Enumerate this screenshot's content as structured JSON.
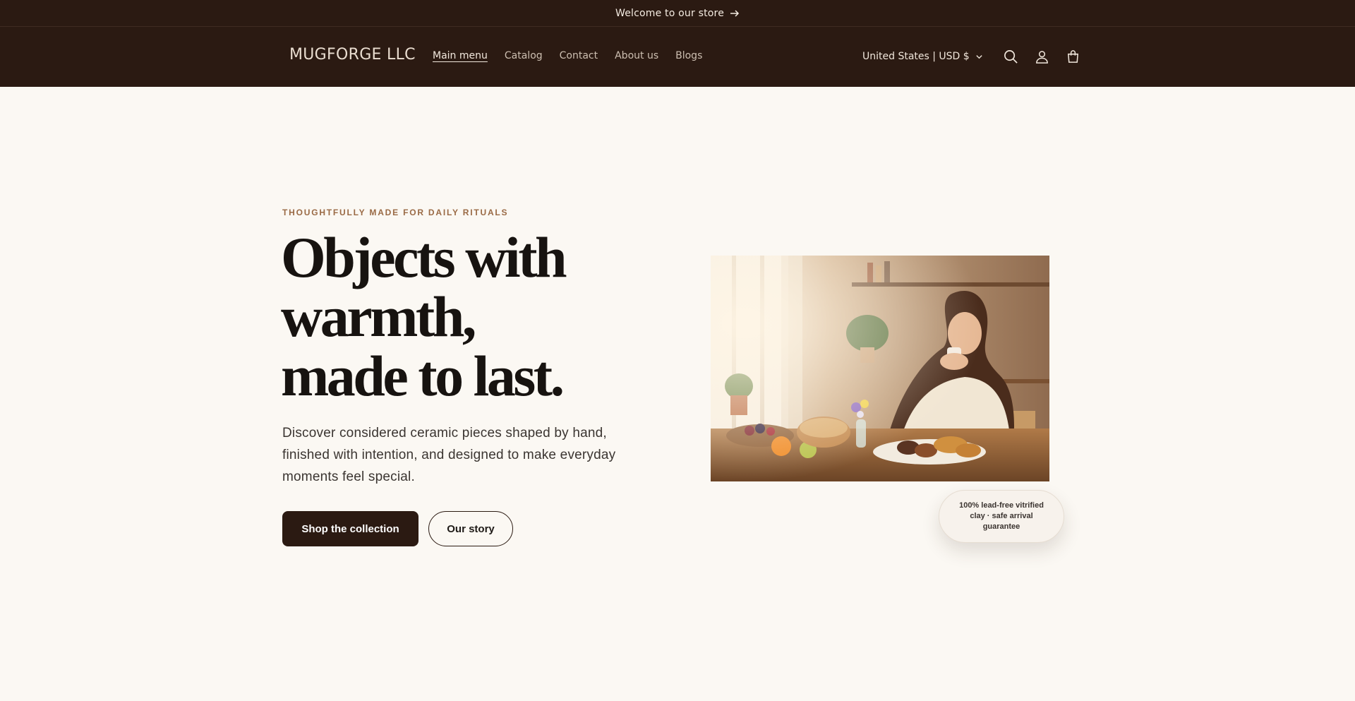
{
  "announcement": {
    "text": "Welcome to our store",
    "icon": "arrow-right-icon"
  },
  "header": {
    "logo": "MUGFORGE LLC",
    "nav": [
      {
        "label": "Main menu",
        "active": true
      },
      {
        "label": "Catalog",
        "active": false
      },
      {
        "label": "Contact",
        "active": false
      },
      {
        "label": "About us",
        "active": false
      },
      {
        "label": "Blogs",
        "active": false
      }
    ],
    "country_selector": "United States | USD $",
    "icons": [
      "search-icon",
      "account-icon",
      "cart-icon"
    ]
  },
  "hero": {
    "eyebrow": "THOUGHTFULLY MADE FOR DAILY RITUALS",
    "headline_lines": [
      "Objects with",
      "warmth,",
      "made to last."
    ],
    "subtext": "Discover considered ceramic pieces shaped by hand, finished with intention, and designed to make everyday moments feel special.",
    "primary_button": "Shop the collection",
    "secondary_button": "Our story",
    "badge": "100% lead-free vitrified clay · safe arrival guarantee"
  },
  "colors": {
    "header_bg": "#2b1a12",
    "page_bg": "#fbf8f3",
    "accent_eyebrow": "#9a6a45",
    "button_primary": "#2b1a12"
  }
}
